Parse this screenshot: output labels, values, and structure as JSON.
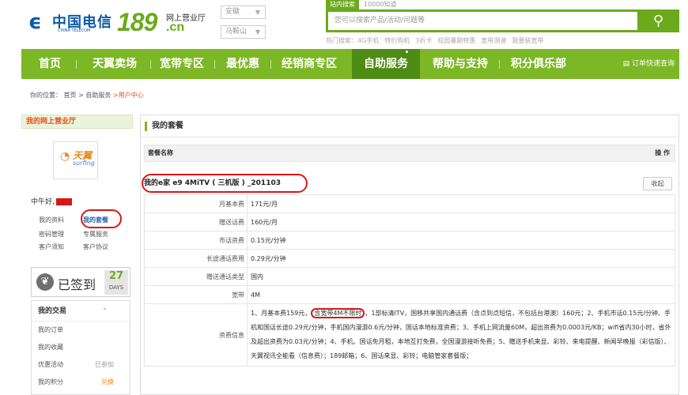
{
  "header": {
    "logo_cn": "中国电信",
    "logo_en": "CHINA TELECOM",
    "logo_number": "189",
    "logo_hall": "网上营业厅",
    "logo_domain": ".cn",
    "province_select": "安徽",
    "city_select": "马鞍山",
    "search_tab_active": "站内搜索",
    "search_tab_other": "10000知道",
    "search_placeholder": "您可以搜索产品/活动/问题等",
    "hot_label": "热门搜索：",
    "hot_terms": [
      "4G手机",
      "特价购机",
      "3折卡",
      "校园暑期特惠",
      "宽带测速",
      "我要装宽带"
    ]
  },
  "nav": {
    "items": [
      "首页",
      "天翼卖场",
      "宽带专区",
      "最优惠",
      "经销商专区",
      "自助服务",
      "帮助与支持",
      "积分俱乐部"
    ],
    "active_index": 5,
    "quick_query": "订单快速查询"
  },
  "breadcrumb": {
    "prefix": "你的位置：",
    "home": "首页",
    "sep": ">",
    "section": "自助服务",
    "current": "用户中心"
  },
  "sidebar": {
    "title": "我的网上营业厅",
    "avatar_brand": "天翼",
    "avatar_sub": "surfing",
    "greeting": "中午好,",
    "links_row1": [
      "我的资料",
      "我的套餐"
    ],
    "links_row2": [
      "密码管理",
      "专属服务"
    ],
    "links_row3": [
      "客户须知",
      "客户协议"
    ],
    "signin_text": "已签到",
    "signin_days": "27",
    "signin_days_label": "DAYS",
    "trade_title": "我的交易",
    "trade_items": [
      {
        "label": "我的订单",
        "extra": ""
      },
      {
        "label": "我的收藏",
        "extra": ""
      },
      {
        "label": "优惠活动",
        "extra": "已参加"
      },
      {
        "label": "我的积分",
        "extra": "兑换"
      }
    ]
  },
  "main": {
    "title": "我的套餐",
    "col_name": "套餐名称",
    "col_action": "操 作",
    "plan_name": "我的e家 e9 4MiTV ( 三机版 ) _201103",
    "collapse_button": "收起",
    "rows": [
      {
        "k": "月基本费",
        "v": "171元/月"
      },
      {
        "k": "赠送话费",
        "v": "160元/月"
      },
      {
        "k": "市话资费",
        "v": "0.15元/分钟"
      },
      {
        "k": "长途通话费用",
        "v": "0.29元/分钟"
      },
      {
        "k": "赠送通话类型",
        "v": "国内"
      },
      {
        "k": "宽带",
        "v": "4M"
      }
    ],
    "info_key": "资费信息",
    "info_part1": "1、月基本费159元，",
    "info_highlight": "含宽带4M不限时",
    "info_part2": "，1部标清ITV，国移共享国内通话费（含点到点短信，不包括台港澳）160元；2、手机市话0.15元/分钟、手机和国话长途0.29元/分钟，手机国内漫游0.6元/分钟，国话本地标准资费；3、手机上网流量60M，超出资费为0.0003元/KB；wifi省内30小时，省外及超出资费为0.03元/分钟；4、手机、国话免月租，本地互打免费，全国漫游接听免费；5、赠送手机来显、彩铃、来电提醒、新闻早晚报（彩信版）、天翼视讯全能看（信息费）；189邮箱；6、国话来显、彩铃；电脑管家套餐版；"
  }
}
